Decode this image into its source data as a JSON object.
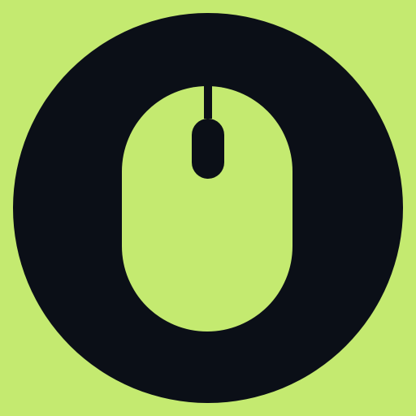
{
  "app_icon": {
    "icon": "mouse-icon",
    "colors": {
      "background": "#c4ea70",
      "circle": "#0b0f17",
      "mouse_body": "#c4ea70",
      "details": "#0b0f17"
    }
  }
}
